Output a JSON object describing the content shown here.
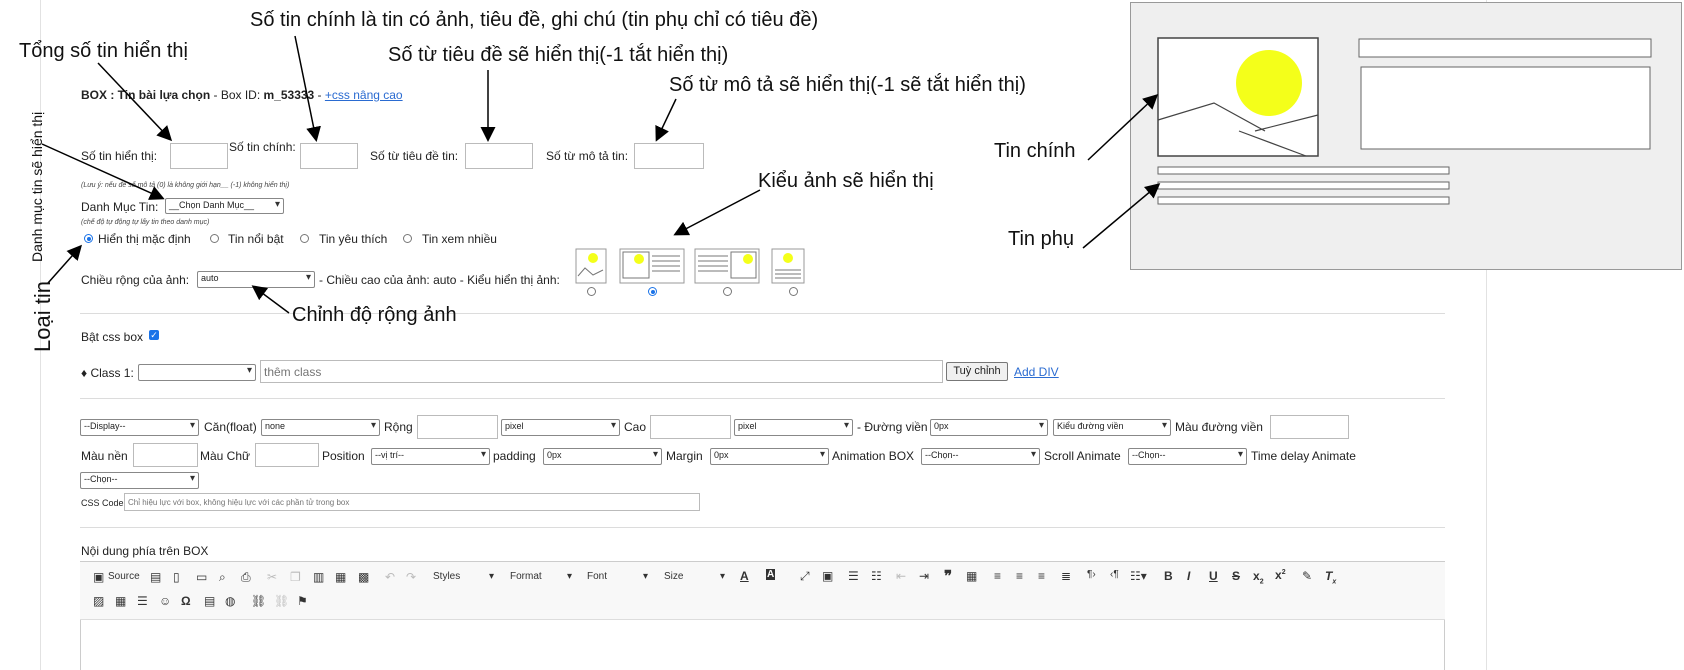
{
  "box": {
    "prefix": "BOX : ",
    "name": "Tin bài lựa chọn",
    "id_label": " - Box ID: ",
    "id_value": "m_53333",
    "sep": " - ",
    "css_link": "+css nâng cao"
  },
  "counts": {
    "total_label": "Số tin hiển thị:",
    "main_label": "Số tin chính:",
    "title_words_label": "Số từ tiêu đề tin:",
    "desc_words_label": "Số từ mô tả tin:",
    "note": "(Lưu ý: nếu để số mô tả (0) là không giới hạn__ (-1) không hiển thị)"
  },
  "category": {
    "label": "Danh Mục Tin:",
    "selected": "__Chọn Danh Mục__",
    "note": "(chế độ tự động tự lấy tin theo danh mục)"
  },
  "news_types": [
    {
      "label": "Hiển thị mặc định",
      "checked": true
    },
    {
      "label": "Tin nổi bật",
      "checked": false
    },
    {
      "label": "Tin yêu thích",
      "checked": false
    },
    {
      "label": "Tin xem nhiều",
      "checked": false
    }
  ],
  "image": {
    "width_label": "Chiều rộng của ảnh:",
    "width_value": "auto",
    "height_text": " - Chiều cao của ảnh: auto - Kiểu hiển thị ảnh:",
    "selected_style_index": 1
  },
  "css_box": {
    "label": "Bật css box",
    "checked": true
  },
  "class_row": {
    "label": "♦ Class 1:",
    "placeholder": "thêm class",
    "button": "Tuỳ chỉnh",
    "add_link": "Add DIV"
  },
  "style_row1": {
    "display": "--Display--",
    "float_label": "Căn(float)",
    "float_value": "none",
    "width_label": "Rộng",
    "width_unit": "pixel",
    "height_label": "Cao",
    "height_unit": "pixel",
    "border_label": "- Đường viền",
    "border_value": "0px",
    "border_style": "Kiểu đường viền",
    "border_color_label": "Màu đường viền"
  },
  "style_row2": {
    "bg_label": "Màu nền",
    "color_label": "Màu Chữ",
    "position_label": "Position",
    "position_value": "--vị trí--",
    "padding_label": "padding",
    "padding_value": "0px",
    "margin_label": "Margin",
    "margin_value": "0px",
    "anim_label": "Animation BOX",
    "anim_value": "--Chọn--",
    "scroll_label": "Scroll Animate",
    "scroll_value": "--Chọn--",
    "delay_label": "Time delay Animate",
    "delay_value": "--Chọn--"
  },
  "css_code": {
    "label": "CSS Code",
    "placeholder": "Chỉ hiệu lực với box, không hiệu lực với các phần tử trong box"
  },
  "editor": {
    "title": "Nội dung phía trên BOX",
    "source": "Source",
    "styles": "Styles",
    "format": "Format",
    "font": "Font",
    "size": "Size"
  },
  "annotations": {
    "total": "Tổng số tin hiển thị",
    "main": "Số tin chính là tin có ảnh, tiêu đề, ghi chú (tin phụ chỉ có tiêu đề)",
    "title_words": "Số từ tiêu đề sẽ hiển thị(-1 tắt hiển thị)",
    "desc_words": "Số từ mô tả sẽ hiển thị(-1 sẽ tắt hiển thị)",
    "category_vertical": "Danh mục tin sẽ hiển thị",
    "news_type_vertical": "Loại tin",
    "image_style": "Kiểu ảnh sẽ hiển thị",
    "image_width": "Chỉnh độ rộng ảnh",
    "main_news": "Tin chính",
    "sub_news": "Tin phụ"
  },
  "colors": {
    "sun": "#f4ff1a",
    "link": "#2a6bd1",
    "radio_on": "#1a73e8"
  }
}
